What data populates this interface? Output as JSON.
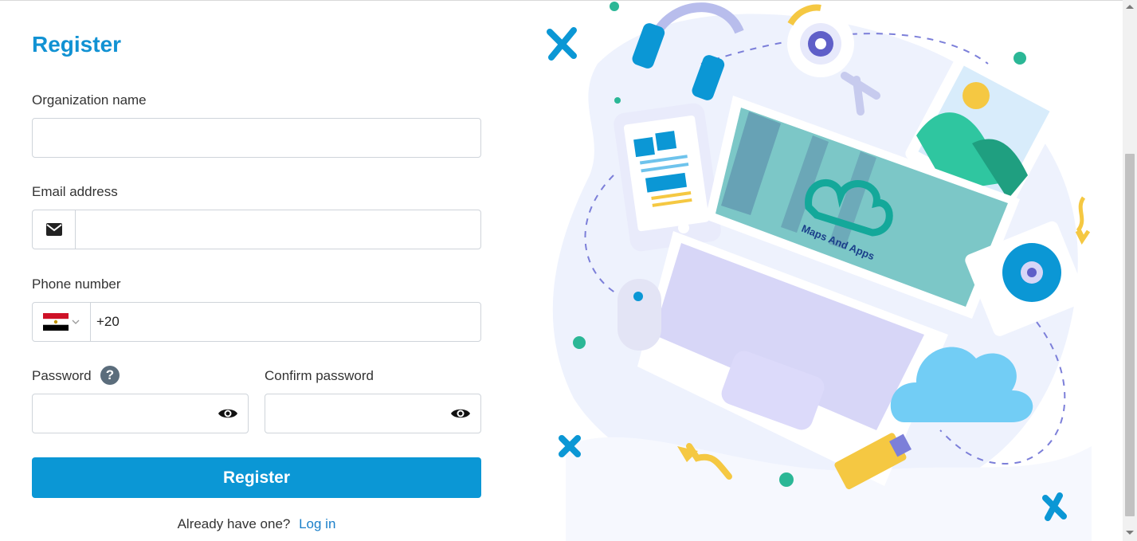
{
  "form": {
    "title": "Register",
    "org_label": "Organization name",
    "org_value": "",
    "email_label": "Email address",
    "email_value": "",
    "phone_label": "Phone number",
    "phone_value": "+20",
    "password_label": "Password",
    "password_help": "?",
    "confirm_label": "Confirm password",
    "submit_label": "Register",
    "footer_text": "Already have one?",
    "login_link": "Log in"
  },
  "illustration": {
    "logo_text": "Maps And Apps"
  },
  "colors": {
    "accent": "#0b97d5",
    "title": "#1192d3",
    "link": "#1a7fc9"
  },
  "icons": [
    "envelope-icon",
    "egypt-flag-icon",
    "chevron-down-icon",
    "help-icon",
    "eye-icon"
  ]
}
